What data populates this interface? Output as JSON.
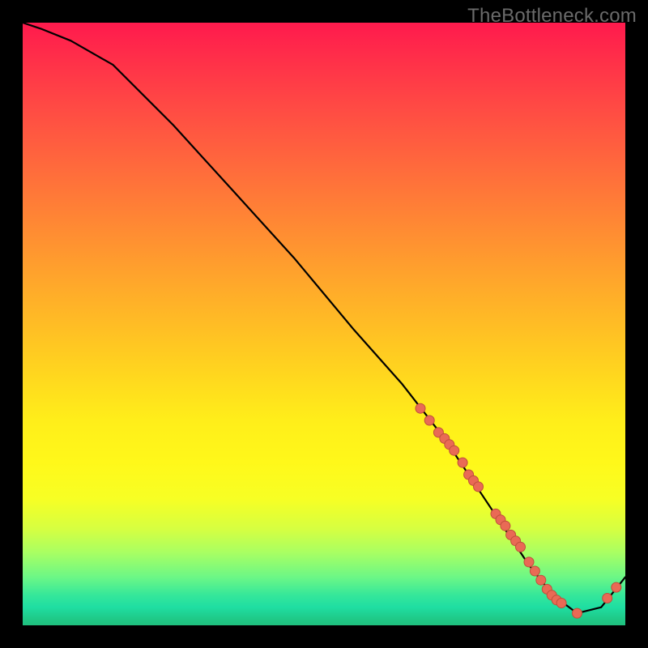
{
  "watermark": "TheBottleneck.com",
  "chart_data": {
    "type": "line",
    "title": "",
    "xlabel": "",
    "ylabel": "",
    "xlim": [
      0,
      100
    ],
    "ylim": [
      0,
      100
    ],
    "series": [
      {
        "name": "curve",
        "x": [
          0,
          3,
          8,
          15,
          25,
          35,
          45,
          55,
          63,
          70,
          76,
          80,
          84,
          88,
          92,
          96,
          100
        ],
        "y": [
          100,
          99,
          97,
          93,
          83,
          72,
          61,
          49,
          40,
          31,
          22,
          16,
          10,
          5,
          2,
          3,
          8
        ]
      }
    ],
    "markers": {
      "name": "dots",
      "x": [
        66,
        67.5,
        69,
        70,
        70.8,
        71.6,
        73,
        74,
        74.8,
        75.6,
        78.5,
        79.3,
        80.1,
        81,
        81.8,
        82.6,
        84,
        85,
        86,
        87,
        87.8,
        88.6,
        89.4,
        92,
        97,
        98.5
      ],
      "y": [
        36,
        34,
        32,
        31,
        30,
        29,
        27,
        25,
        24,
        23,
        18.5,
        17.5,
        16.5,
        15,
        14,
        13,
        10.5,
        9,
        7.5,
        6,
        5,
        4.2,
        3.7,
        2,
        4.5,
        6.3
      ]
    },
    "colors": {
      "curve": "#000000",
      "markers": "#e96a55",
      "gradient_top": "#ff1a4d",
      "gradient_bottom": "#1fbf7e"
    }
  }
}
